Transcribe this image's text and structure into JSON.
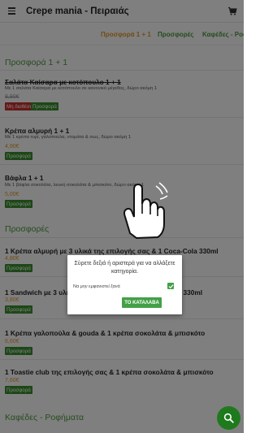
{
  "header": {
    "title": "Crepe mania - Πειραιάς",
    "menu_icon": "hamburger-menu-icon",
    "cart_icon": "cart-icon"
  },
  "tabs": [
    {
      "label": "Προσφορά 1 + 1",
      "active": true
    },
    {
      "label": "Προσφορές"
    },
    {
      "label": "Καφέδες - Ροφήματα"
    }
  ],
  "sections": {
    "offer_1_1": {
      "title": "Προσφορά 1 + 1",
      "items": [
        {
          "name": "Σαλάτα Καίσαρα με κοτόπουλο 1 + 1",
          "desc": "Με 1 σαλάτα Καίσαρα με κοτόπουλο σε κανονικό μέγεθος, δώρο ακόμη 1",
          "price": "8,90€",
          "badges": [
            "Μη διαθέσιμο",
            "Προσφορά"
          ]
        },
        {
          "name": "Κρέπα αλμυρή 1 + 1",
          "desc": "Με 1 κρέπα τυρί, γαλοπούλα, ντομάτα & σως, δώρο ακόμη 1",
          "price": "4,90€",
          "badges": [
            "Προσφορά"
          ]
        },
        {
          "name": "Βάφλα 1 + 1",
          "desc": "Με 1 βάφλα σοκολάτα, λευκή σοκολάτα & μπισκότο, δώρο ακόμη 1",
          "price": "5,00€",
          "badges": [
            "Προσφορά"
          ]
        }
      ]
    },
    "offers": {
      "title": "Προσφορές",
      "items": [
        {
          "name": "1 Κρέπα αλμυρή με 3 υλικά της επιλογής σας & 1 Coca-Cola 330ml",
          "price": "4,80€",
          "badges": [
            "Προσφορά"
          ]
        },
        {
          "name": "1 Sandwich με 3 υλικά της επιλογής σας & 1 Coca-Cola 330ml",
          "price": "3,80€",
          "badges": [
            "Προσφορά"
          ]
        },
        {
          "name": "1 Κρέπα γαλοπούλα & gouda & 1 κρέπα σοκολάτα & μπισκότο",
          "price": "6,60€",
          "badges": [
            "Προσφορά"
          ]
        },
        {
          "name": "1 Toastie club της επιλογής σας & 1 κρέπα σοκολάτα & μπισκότο",
          "price": "7,60€",
          "badges": [
            "Προσφορά"
          ]
        }
      ]
    },
    "coffee": {
      "title": "Καφέδες - Ροφήματα"
    }
  },
  "dialog": {
    "message": "Σύρετε δεξιά ή αριστερά για να αλλάξετε κατηγορία.",
    "checkbox_label": "Να μην εμφανιστεί ξανά",
    "checkbox_checked": true,
    "ok_label": "ΤΟ ΚΑΤΑΛΑΒΑ"
  },
  "gesture_icon": "swipe-hand-icon",
  "fab_icon": "search-icon",
  "colors": {
    "accent_green": "#4c9b3f",
    "badge_green": "#3a8f2e",
    "badge_red": "#c9302c",
    "price_orange": "#e39a2b",
    "dialog_button": "#43a047",
    "fab": "#1e7a1c"
  }
}
